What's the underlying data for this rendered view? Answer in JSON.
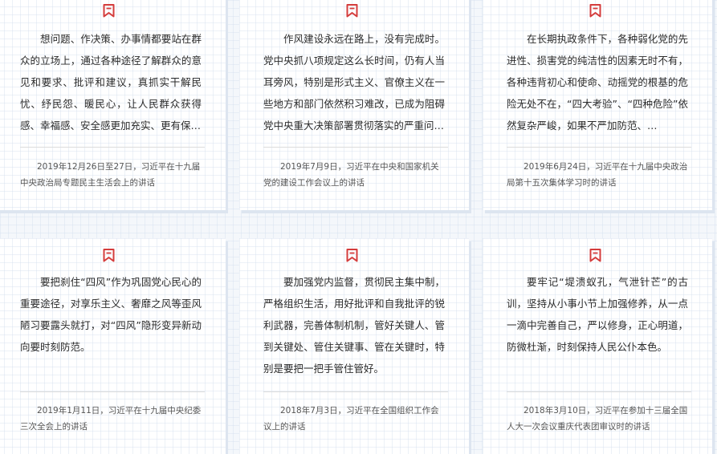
{
  "colors": {
    "bookmark_icon": "#d43c3c",
    "text": "#2b2b2b",
    "source_text": "#555555"
  },
  "icons": {
    "bookmark": "bookmark-icon"
  },
  "quotes": [
    {
      "text": "想问题、作决策、办事情都要站在群众的立场上，通过各种途径了解群众的意见和要求、批评和建议，真抓实干解民忧、纾民怨、暖民心，让人民群众获得感、幸福感、安全感更加充实、更有保…",
      "source": "2019年12月26日至27日，习近平在十九届中央政治局专题民主生活会上的讲话"
    },
    {
      "text": "作风建设永远在路上，没有完成时。党中央抓八项规定这么长时间，仍有人当耳旁风，特别是形式主义、官僚主义在一些地方和部门依然积习难改，已成为阻碍党中央重大决策部署贯彻落实的严重问…",
      "source": "2019年7月9日，习近平在中央和国家机关党的建设工作会议上的讲话"
    },
    {
      "text": "在长期执政条件下，各种弱化党的先进性、损害党的纯洁性的因素无时不有，各种违背初心和使命、动摇党的根基的危险无处不在，“四大考验”、“四种危险”依然复杂严峻，如果不严加防范、…",
      "source": "2019年6月24日，习近平在十九届中央政治局第十五次集体学习时的讲话"
    },
    {
      "text": "要把刹住“四风”作为巩固党心民心的重要途径，对享乐主义、奢靡之风等歪风陋习要露头就打，对“四风”隐形变异新动向要时刻防范。",
      "source": "2019年1月11日，习近平在十九届中央纪委三次全会上的讲话"
    },
    {
      "text": "要加强党内监督，贯彻民主集中制，严格组织生活，用好批评和自我批评的锐利武器，完善体制机制，管好关键人、管到关键处、管住关键事、管在关键时，特别是要把一把手管住管好。",
      "source": "2018年7月3日，习近平在全国组织工作会议上的讲话"
    },
    {
      "text": "要牢记“堤溃蚁孔，气泄针芒”的古训，坚持从小事小节上加强修养，从一点一滴中完善自己，严以修身，正心明道，防微杜渐，时刻保持人民公仆本色。",
      "source": "2018年3月10日，习近平在参加十三届全国人大一次会议重庆代表团审议时的讲话"
    }
  ]
}
